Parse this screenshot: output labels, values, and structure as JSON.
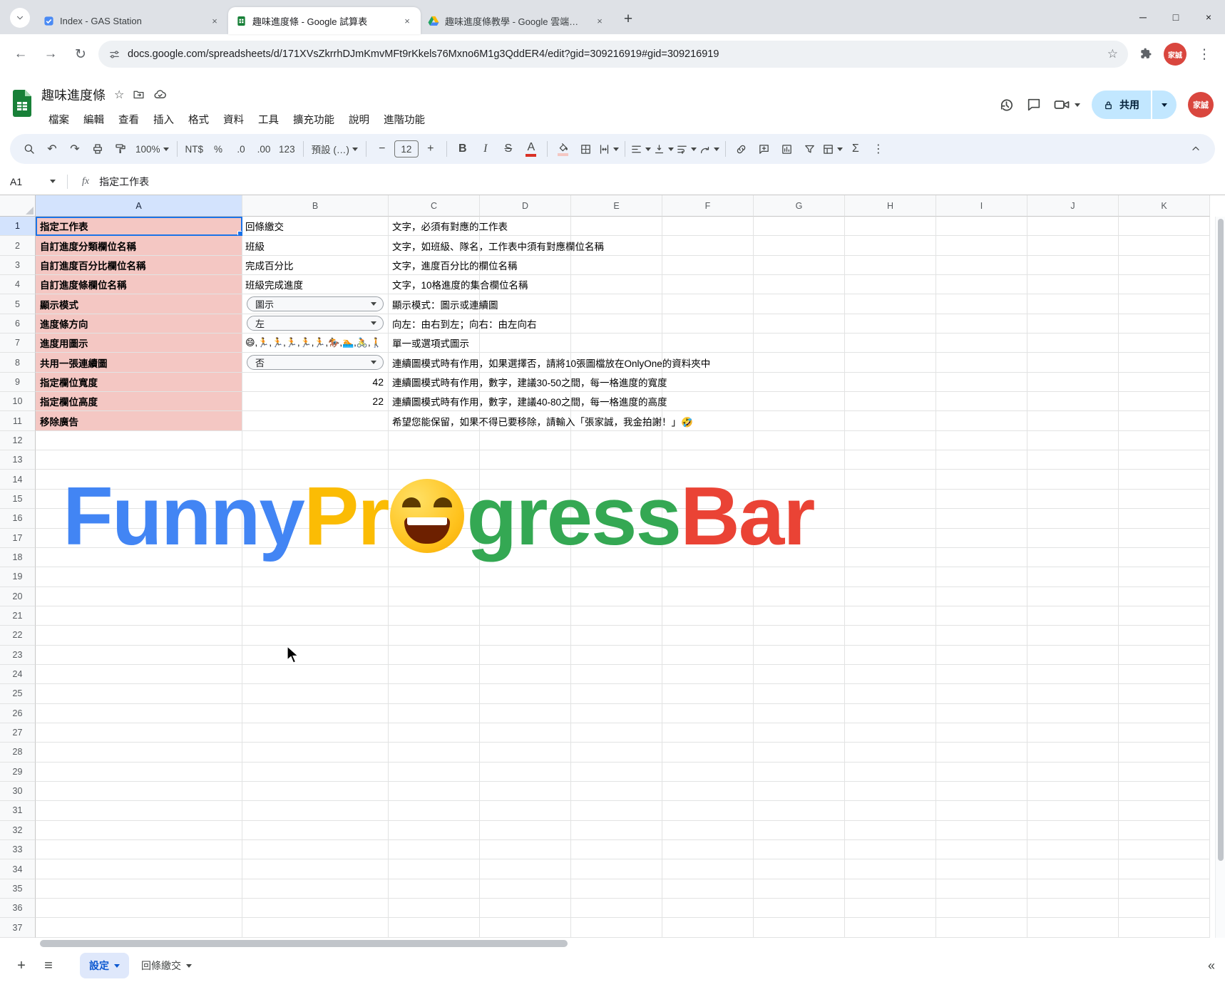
{
  "browser": {
    "tabs": [
      {
        "title": "Index - GAS Station",
        "favicon": "gas",
        "active": false
      },
      {
        "title": "趣味進度條 - Google 試算表",
        "favicon": "sheets",
        "active": true
      },
      {
        "title": "趣味進度條教學 - Google 雲端…",
        "favicon": "drive",
        "active": false
      }
    ],
    "url": "docs.google.com/spreadsheets/d/171XVsZkrrhDJmKmvMFt9rKkels76Mxno6M1g3QddER4/edit?gid=309216919#gid=309216919",
    "profile_initials": "家誠"
  },
  "header": {
    "title": "趣味進度條",
    "menus": [
      "檔案",
      "編輯",
      "查看",
      "插入",
      "格式",
      "資料",
      "工具",
      "擴充功能",
      "說明",
      "進階功能"
    ],
    "share_label": "共用",
    "avatar_text": "家誠"
  },
  "toolbar": {
    "zoom": "100%",
    "currency": "NT$",
    "percent": "%",
    "dec_decrease": ".0",
    "dec_increase": ".00",
    "num_format": "123",
    "font_name": "預設 (…)",
    "font_size": "12",
    "accent_pink": "#f4c7c3",
    "accent_red": "#d93025"
  },
  "formula_bar": {
    "cell_ref": "A1",
    "fx_label": "fx",
    "value": "指定工作表"
  },
  "grid": {
    "col_letters": [
      "A",
      "B",
      "C",
      "D",
      "E",
      "F",
      "G",
      "H",
      "I",
      "J",
      "K"
    ],
    "row_count": 37,
    "selected_cell": "A1",
    "rows": [
      {
        "n": 1,
        "a": "指定工作表",
        "b": {
          "type": "text",
          "value": "回條繳交"
        },
        "c": "文字，必須有對應的工作表"
      },
      {
        "n": 2,
        "a": "自訂進度分類欄位名稱",
        "b": {
          "type": "text",
          "value": "班級"
        },
        "c": "文字，如班級、隊名，工作表中須有對應欄位名稱"
      },
      {
        "n": 3,
        "a": "自訂進度百分比欄位名稱",
        "b": {
          "type": "text",
          "value": "完成百分比"
        },
        "c": "文字，進度百分比的欄位名稱"
      },
      {
        "n": 4,
        "a": "自訂進度條欄位名稱",
        "b": {
          "type": "text",
          "value": "班級完成進度"
        },
        "c": "文字，10格進度的集合欄位名稱"
      },
      {
        "n": 5,
        "a": "顯示模式",
        "b": {
          "type": "dropdown",
          "value": "圖示"
        },
        "c": "顯示模式：圖示或連續圖"
      },
      {
        "n": 6,
        "a": "進度條方向",
        "b": {
          "type": "dropdown",
          "value": "左"
        },
        "c": "向左：由右到左；向右：由左向右"
      },
      {
        "n": 7,
        "a": "進度用圖示",
        "b": {
          "type": "text",
          "value": "😄,🏃,🏃,🏃,🏃,🏃,🏇,🏊,🚴,🚶"
        },
        "c": "單一或選項式圖示"
      },
      {
        "n": 8,
        "a": "共用一張連續圖",
        "b": {
          "type": "dropdown",
          "value": "否"
        },
        "c": "連續圖模式時有作用，如果選擇否，請將10張圖檔放在OnlyOne的資料夾中"
      },
      {
        "n": 9,
        "a": "指定欄位寬度",
        "b": {
          "type": "number",
          "value": "42"
        },
        "c": "連續圖模式時有作用，數字，建議30-50之間，每一格進度的寬度"
      },
      {
        "n": 10,
        "a": "指定欄位高度",
        "b": {
          "type": "number",
          "value": "22"
        },
        "c": "連續圖模式時有作用，數字，建議40-80之間，每一格進度的高度"
      },
      {
        "n": 11,
        "a": "移除廣告",
        "b": {
          "type": "empty",
          "value": ""
        },
        "c": "希望您能保留，如果不得已要移除，請輸入「張家誠，我金拍謝！」🤣"
      }
    ],
    "pink_fill": "#f4c7c3",
    "selection_blue": "#1a73e8"
  },
  "logo": {
    "parts": [
      {
        "text": "Funny",
        "color": "#4285f4"
      },
      {
        "text": "Pr",
        "color": "#fbbc04"
      },
      {
        "emoji": "😄"
      },
      {
        "text": "gress",
        "color": "#34a853"
      },
      {
        "text": "Bar",
        "color": "#ea4335"
      }
    ]
  },
  "sheet_bar": {
    "tabs": [
      {
        "label": "設定",
        "active": true
      },
      {
        "label": "回條繳交",
        "active": false
      }
    ]
  },
  "icons": {
    "back": "←",
    "forward": "→",
    "reload": "↻",
    "star": "☆",
    "kebab": "⋮",
    "close": "×",
    "minimize": "─",
    "maximize": "□",
    "new_tab": "+",
    "undo": "↶",
    "redo": "↷",
    "sigma": "Σ",
    "minus": "−",
    "plus": "+",
    "hamburger": "≡",
    "collapse": "«",
    "bold": "B",
    "italic": "I",
    "strike": "S",
    "text_color": "A"
  }
}
